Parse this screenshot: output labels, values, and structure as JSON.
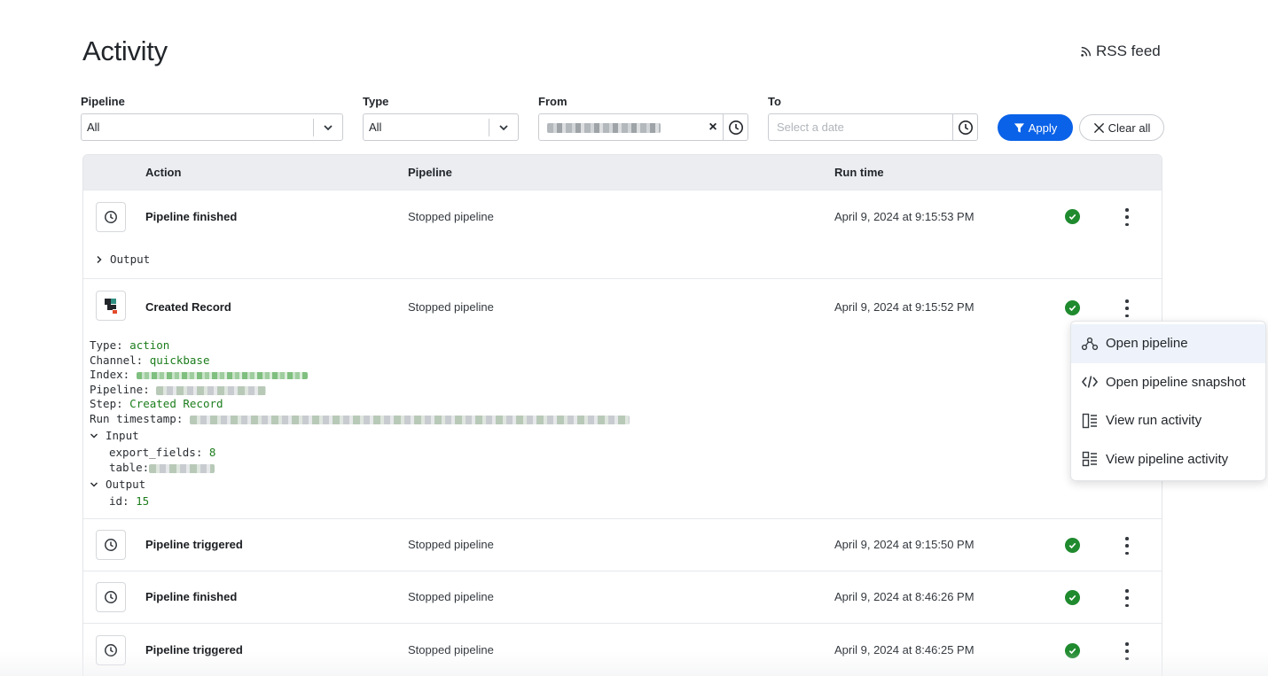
{
  "page": {
    "title": "Activity",
    "rss_label": "RSS feed"
  },
  "filters": {
    "pipeline": {
      "label": "Pipeline",
      "value": "All"
    },
    "type": {
      "label": "Type",
      "value": "All"
    },
    "from": {
      "label": "From"
    },
    "to": {
      "label": "To",
      "placeholder": "Select a date"
    },
    "apply_label": "Apply",
    "clear_label": "Clear all"
  },
  "table": {
    "headers": {
      "action": "Action",
      "pipeline": "Pipeline",
      "run_time": "Run time"
    },
    "rows": [
      {
        "action": "Pipeline finished",
        "pipeline": "Stopped pipeline",
        "run_time": "April 9, 2024 at 9:15:53 PM",
        "output_label": "Output"
      },
      {
        "action": "Created Record",
        "pipeline": "Stopped pipeline",
        "run_time": "April 9, 2024 at 9:15:52 PM"
      },
      {
        "action": "Pipeline triggered",
        "pipeline": "Stopped pipeline",
        "run_time": "April 9, 2024 at 9:15:50 PM"
      },
      {
        "action": "Pipeline finished",
        "pipeline": "Stopped pipeline",
        "run_time": "April 9, 2024 at 8:46:26 PM"
      },
      {
        "action": "Pipeline triggered",
        "pipeline": "Stopped pipeline",
        "run_time": "April 9, 2024 at 8:46:25 PM"
      }
    ],
    "detail": {
      "type_key": "Type:",
      "type_val": "action",
      "channel_key": "Channel:",
      "channel_val": "quickbase",
      "index_key": "Index:",
      "pipeline_key": "Pipeline:",
      "step_key": "Step:",
      "step_val": "Created Record",
      "timestamp_key": "Run timestamp:",
      "input_label": "Input",
      "export_fields_key": "export_fields:",
      "export_fields_val": "8",
      "table_key": "table:",
      "output_label": "Output",
      "id_key": "id:",
      "id_val": "15"
    }
  },
  "menu": {
    "items": [
      {
        "label": "Open pipeline",
        "icon": "pipeline-icon"
      },
      {
        "label": "Open pipeline snapshot",
        "icon": "code-icon"
      },
      {
        "label": "View run activity",
        "icon": "run-activity-icon"
      },
      {
        "label": "View pipeline activity",
        "icon": "pipeline-activity-icon"
      }
    ]
  },
  "colors": {
    "accent": "#0a62e8",
    "success": "#1f8a2e",
    "code_value": "#1c7d1c"
  }
}
